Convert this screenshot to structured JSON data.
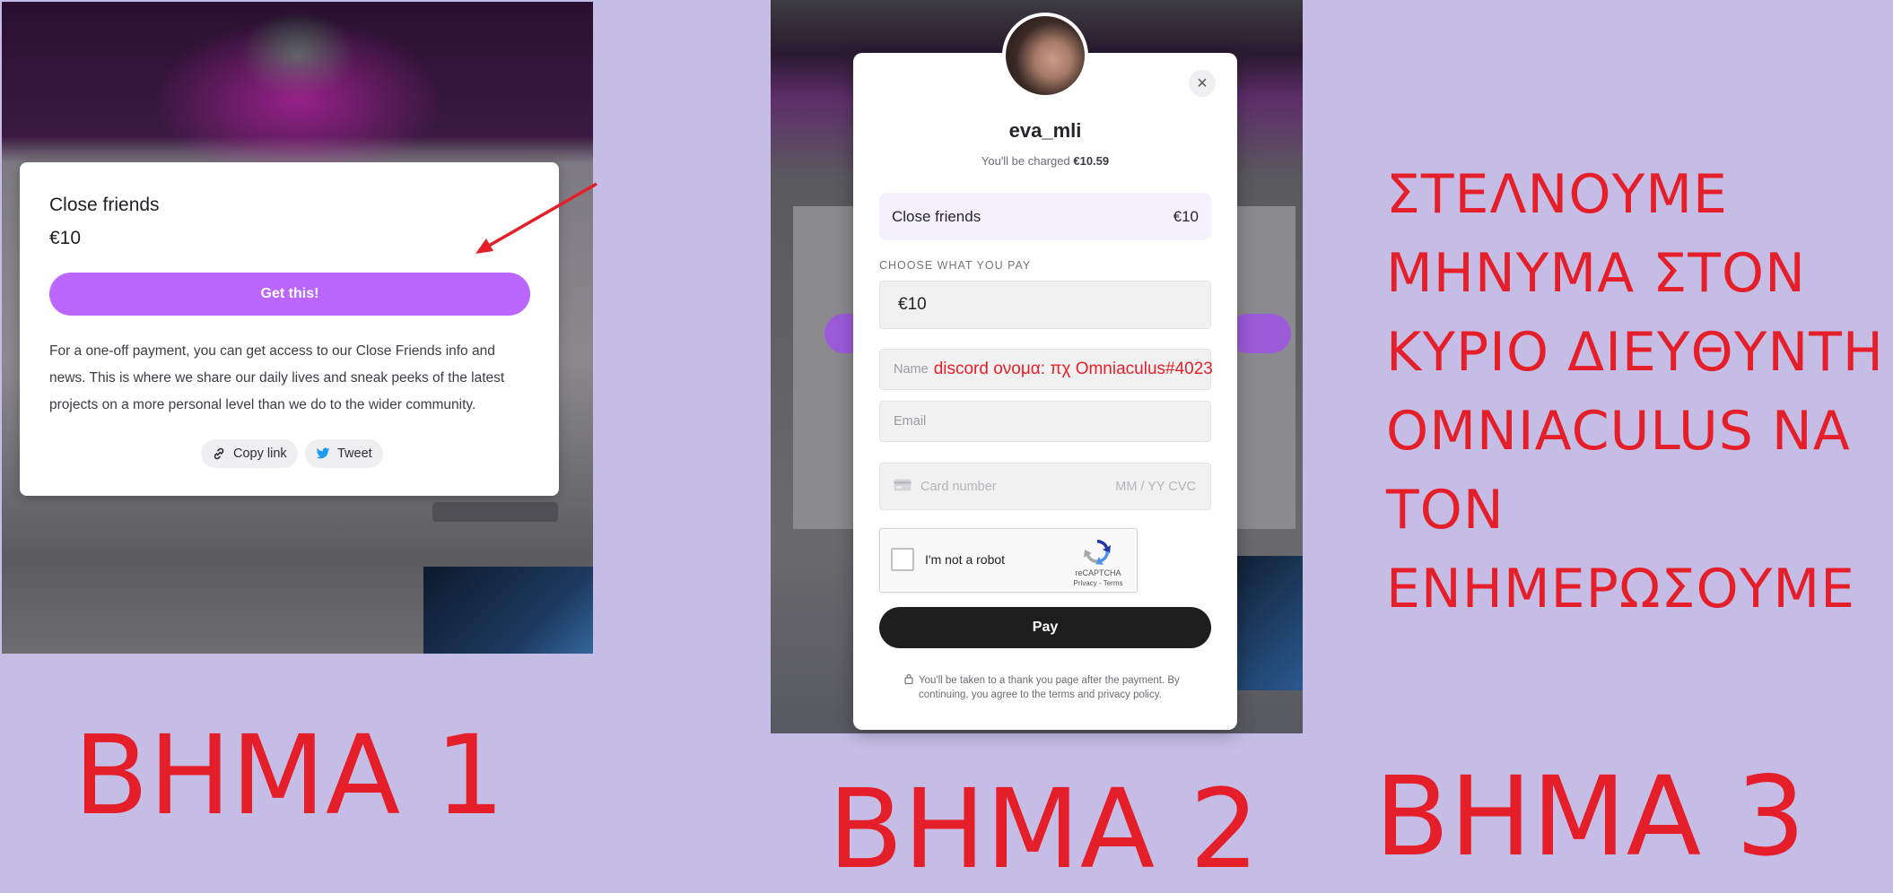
{
  "panel1": {
    "card": {
      "title": "Close friends",
      "price": "€10",
      "cta_label": "Get this!",
      "description": "For a one-off payment, you can get access to our Close Friends info and news. This is where we share our daily lives and sneak peeks of the latest projects on a more personal level than we do to the wider  community.",
      "copy_link_label": "Copy link",
      "tweet_label": "Tweet"
    },
    "colors": {
      "accent": "#bb66ff",
      "annotation": "#e51f2a"
    }
  },
  "panel2": {
    "modal": {
      "username": "eva_mli",
      "charged_prefix": "You'll be charged ",
      "charged_amount": "€10.59",
      "tier_name": "Close friends",
      "tier_price": "€10",
      "choose_label": "CHOOSE WHAT YOU PAY",
      "amount_value": "€10",
      "name_placeholder": "Name",
      "name_annotation": "discord ονομα: πχ Omniaculus#4023",
      "email_placeholder": "Email",
      "card_number_placeholder": "Card number",
      "card_expiry_placeholder": "MM / YY CVC",
      "captcha_label": "I'm not a robot",
      "captcha_brand": "reCAPTCHA",
      "captcha_terms": "Privacy - Terms",
      "pay_label": "Pay",
      "footnote": "You'll be taken to a thank you page after the payment. By continuing, you agree to the terms and privacy policy."
    },
    "colors": {
      "tier_bg": "#f6f1ff",
      "pay_button": "#1e1e1e"
    }
  },
  "annotations": {
    "step1": "BHMA 1",
    "step2": "BHMA 2",
    "step3": "BHMA 3",
    "instruction_lines": [
      "ΣΤΕΛΝΟΥΜΕ",
      "ΜΗΝΥΜΑ  ΣΤΟΝ",
      "ΚΥΡΙΟ ΔΙΕΥΘΥΝΤΗ",
      "OMNIACULUS ΝΑ",
      "ΤΟΝ",
      "ΕΝΗΜΕΡΩΣΟΥΜΕ"
    ]
  },
  "icons": [
    "link-icon",
    "twitter-icon",
    "close-icon",
    "credit-card-icon",
    "recaptcha-icon",
    "lock-icon",
    "arrow-icon"
  ]
}
